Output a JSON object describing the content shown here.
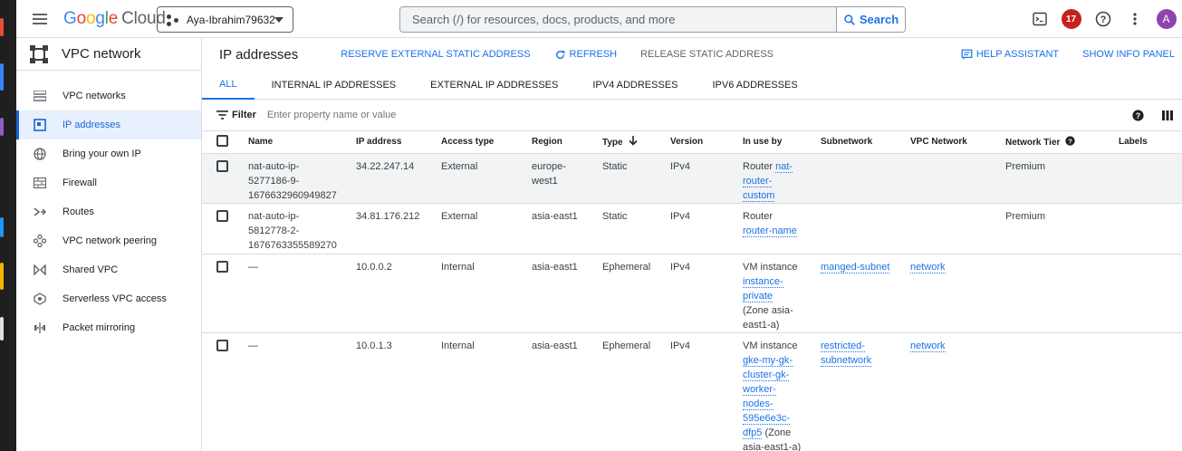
{
  "header": {
    "logo_google": "Google",
    "logo_cloud": "Cloud",
    "project": "Aya-Ibrahim79632",
    "search_placeholder": "Search (/) for resources, docs, products, and more",
    "search_button": "Search",
    "notifications_count": "17",
    "avatar_letter": "A"
  },
  "sidebar": {
    "title": "VPC network",
    "items": [
      {
        "label": "VPC networks",
        "icon": "vpc-networks-icon"
      },
      {
        "label": "IP addresses",
        "icon": "ip-addresses-icon",
        "active": true
      },
      {
        "label": "Bring your own IP",
        "icon": "globe-icon"
      },
      {
        "label": "Firewall",
        "icon": "firewall-icon"
      },
      {
        "label": "Routes",
        "icon": "routes-icon"
      },
      {
        "label": "VPC network peering",
        "icon": "peering-icon"
      },
      {
        "label": "Shared VPC",
        "icon": "shared-vpc-icon"
      },
      {
        "label": "Serverless VPC access",
        "icon": "serverless-icon"
      },
      {
        "label": "Packet mirroring",
        "icon": "packet-mirroring-icon"
      }
    ]
  },
  "main": {
    "title": "IP addresses",
    "actions": {
      "reserve": "RESERVE EXTERNAL STATIC ADDRESS",
      "refresh": "REFRESH",
      "release": "RELEASE STATIC ADDRESS",
      "help": "HELP ASSISTANT",
      "info": "SHOW INFO PANEL"
    },
    "tabs": [
      "ALL",
      "INTERNAL IP ADDRESSES",
      "EXTERNAL IP ADDRESSES",
      "IPV4 ADDRESSES",
      "IPV6 ADDRESSES"
    ],
    "filter_label": "Filter",
    "filter_placeholder": "Enter property name or value"
  },
  "table": {
    "columns": [
      "Name",
      "IP address",
      "Access type",
      "Region",
      "Type",
      "Version",
      "In use by",
      "Subnetwork",
      "VPC Network",
      "Network Tier",
      "Labels"
    ],
    "rows": [
      {
        "name": [
          "nat-auto-ip-",
          "5277186-9-",
          "1676632960949827"
        ],
        "ip": "34.22.247.14",
        "access": "External",
        "region": [
          "europe-",
          "west1"
        ],
        "type": "Static",
        "version": "IPv4",
        "inuse_prefix": "Router ",
        "inuse_links": [
          "nat-",
          "router-",
          "custom"
        ],
        "inuse_suffix": [],
        "subnetwork": [],
        "vpc": "",
        "tier": "Premium"
      },
      {
        "name": [
          "nat-auto-ip-",
          "5812778-2-",
          "1676763355589270"
        ],
        "ip": "34.81.176.212",
        "access": "External",
        "region": [
          "asia-east1"
        ],
        "type": "Static",
        "version": "IPv4",
        "inuse_prefix": "Router",
        "inuse_links": [
          "router-name"
        ],
        "inuse_suffix": [],
        "subnetwork": [],
        "vpc": "",
        "tier": "Premium"
      },
      {
        "name": [
          "—"
        ],
        "ip": "10.0.0.2",
        "access": "Internal",
        "region": [
          "asia-east1"
        ],
        "type": "Ephemeral",
        "version": "IPv4",
        "inuse_prefix": "VM instance",
        "inuse_links": [
          "instance-",
          "private"
        ],
        "inuse_suffix": [
          "(Zone asia-",
          "east1-a)"
        ],
        "subnetwork": [
          "manged-subnet"
        ],
        "vpc": "network",
        "tier": ""
      },
      {
        "name": [
          "—"
        ],
        "ip": "10.0.1.3",
        "access": "Internal",
        "region": [
          "asia-east1"
        ],
        "type": "Ephemeral",
        "version": "IPv4",
        "inuse_prefix": "VM instance",
        "inuse_links": [
          "gke-my-gk-",
          "cluster-gk-",
          "worker-",
          "nodes-",
          "595e6e3c-",
          "dfp5"
        ],
        "inuse_suffix": [
          " (Zone",
          "asia-east1-a)"
        ],
        "subnetwork": [
          "restricted-",
          "subnetwork"
        ],
        "vpc": "network",
        "tier": ""
      }
    ]
  }
}
